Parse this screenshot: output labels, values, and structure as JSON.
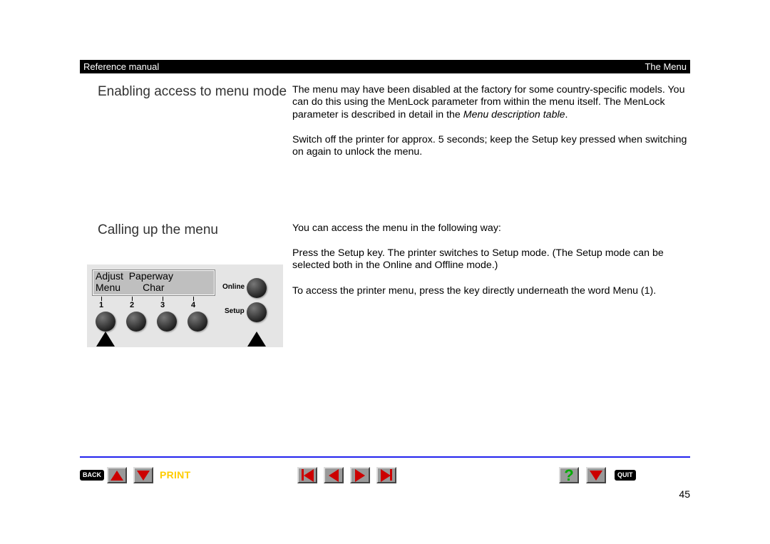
{
  "header": {
    "left": "Reference manual",
    "right": "The Menu"
  },
  "section1": {
    "heading": "Enabling access to menu mode",
    "p1a": "The menu may have been disabled at the factory for some country-spe­cific models. You can do this using the MenLock  parameter from within the menu itself. The MenLock parameter is described in detail in the ",
    "p1b_italic": "Menu description table",
    "p1c": ".",
    "p2": "Switch off the printer for approx. 5 seconds; keep the Setup  key pressed when switching on again to unlock the menu."
  },
  "section2": {
    "heading": "Calling up the menu",
    "p1": "You can access the menu in the following way:",
    "p2": "Press the Setup  key. The printer switches to Setup mode. (The Setup mode can be selected both in the Online and Offline mode.)",
    "p3": "To access the printer menu, press the key directly underneath the word Menu  (1)."
  },
  "panel": {
    "lcd_row1": "Adjust  Paperway",
    "lcd_row2": "Menu        Char",
    "nums": {
      "n1": "1",
      "n2": "2",
      "n3": "3",
      "n4": "4"
    },
    "online": "Online",
    "setup": "Setup"
  },
  "nav": {
    "back": "BACK",
    "print": "PRINT",
    "quit": "QUIT",
    "help": "?"
  },
  "page_number": "45"
}
